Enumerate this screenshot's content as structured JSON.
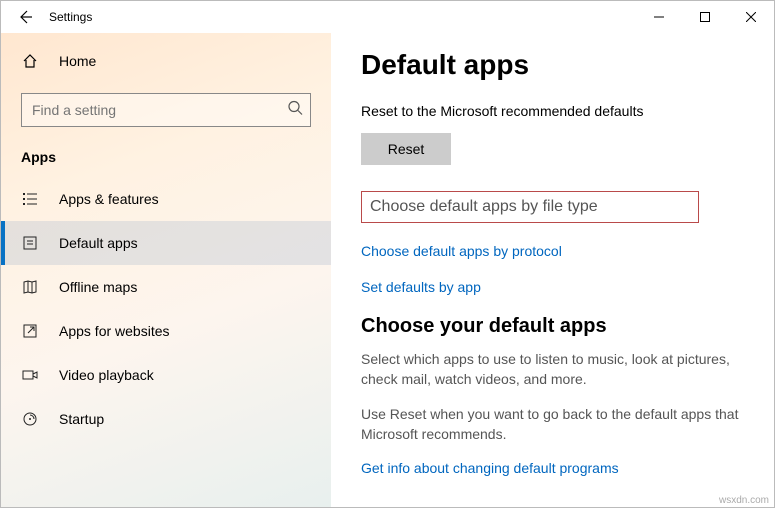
{
  "titlebar": {
    "title": "Settings"
  },
  "sidebar": {
    "home_label": "Home",
    "search_placeholder": "Find a setting",
    "section_label": "Apps",
    "items": [
      {
        "label": "Apps & features"
      },
      {
        "label": "Default apps"
      },
      {
        "label": "Offline maps"
      },
      {
        "label": "Apps for websites"
      },
      {
        "label": "Video playback"
      },
      {
        "label": "Startup"
      }
    ]
  },
  "content": {
    "heading": "Default apps",
    "reset_desc": "Reset to the Microsoft recommended defaults",
    "reset_label": "Reset",
    "link_filetype": "Choose default apps by file type",
    "link_protocol": "Choose default apps by protocol",
    "link_byapp": "Set defaults by app",
    "subheading": "Choose your default apps",
    "para1": "Select which apps to use to listen to music, look at pictures, check mail, watch videos, and more.",
    "para2": "Use Reset when you want to go back to the default apps that Microsoft recommends.",
    "link_info": "Get info about changing default programs"
  },
  "watermark": "wsxdn.com"
}
